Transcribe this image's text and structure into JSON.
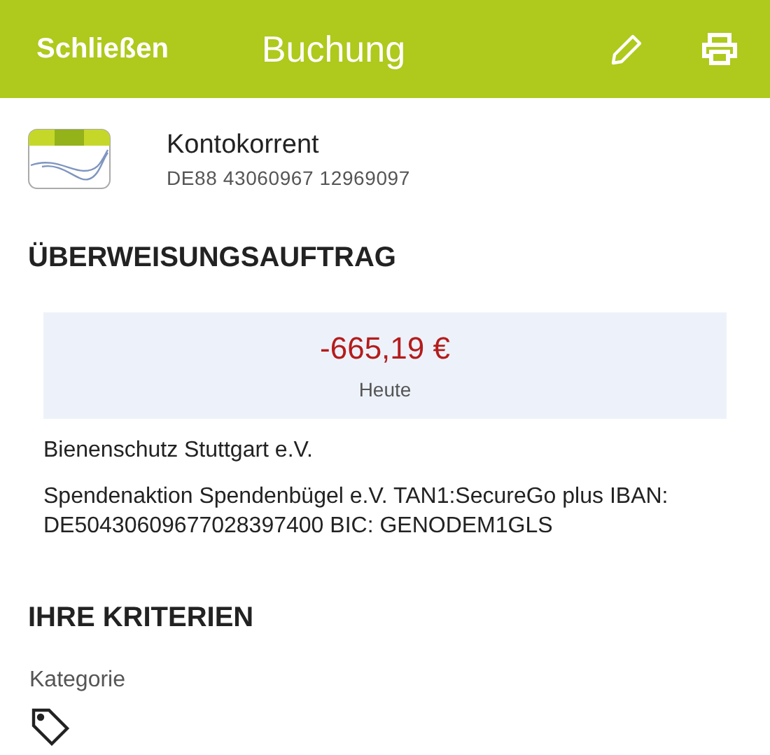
{
  "header": {
    "close_label": "Schließen",
    "title": "Buchung"
  },
  "account": {
    "name": "Kontokorrent",
    "iban": "DE88 43060967 12969097"
  },
  "transfer": {
    "heading": "ÜBERWEISUNGSAUFTRAG",
    "amount": "-665,19 €",
    "date": "Heute",
    "recipient": "Bienenschutz Stuttgart e.V.",
    "purpose": "Spendenaktion Spendenbügel e.V. TAN1:SecureGo plus IBAN: DE50430609677028397400 BIC: GENODEM1GLS"
  },
  "criteria": {
    "heading": "IHRE KRITERIEN",
    "category_label": "Kategorie"
  }
}
